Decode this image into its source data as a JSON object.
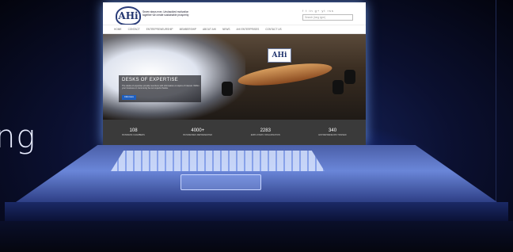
{
  "side_text": "ng",
  "site": {
    "logo_text": "AHi",
    "tagline": "Seven steps ever, Unshackled motivation together we create sustainable prosperity",
    "search_placeholder": "Search (long type)",
    "social_icons": "f t in g+ yt rss",
    "nav": [
      "HOME",
      "CONTACT",
      "ENTREPRENEURSHIP",
      "MEMBERSHIP",
      "ABOUT AHI",
      "NEWS",
      "AHI ENTERPRISES",
      "CONTACT US"
    ],
    "hero": {
      "title": "DESKS OF EXPERTISE",
      "text": "The desks of expertise provide members with information on topics of interest. Within your business or community be our experts thanks.",
      "button": "Click Here",
      "logo_text": "AHi"
    },
    "stats": [
      {
        "number": "108",
        "label": "BUSINESS CHAMBERS"
      },
      {
        "number": "4000+",
        "label": "BUSINESSES REPRESENTED"
      },
      {
        "number": "2283",
        "label": "EMPLOYERS' ORGANISATION"
      },
      {
        "number": "340",
        "label": "ENTREPRENEURS TRAINED"
      }
    ]
  }
}
